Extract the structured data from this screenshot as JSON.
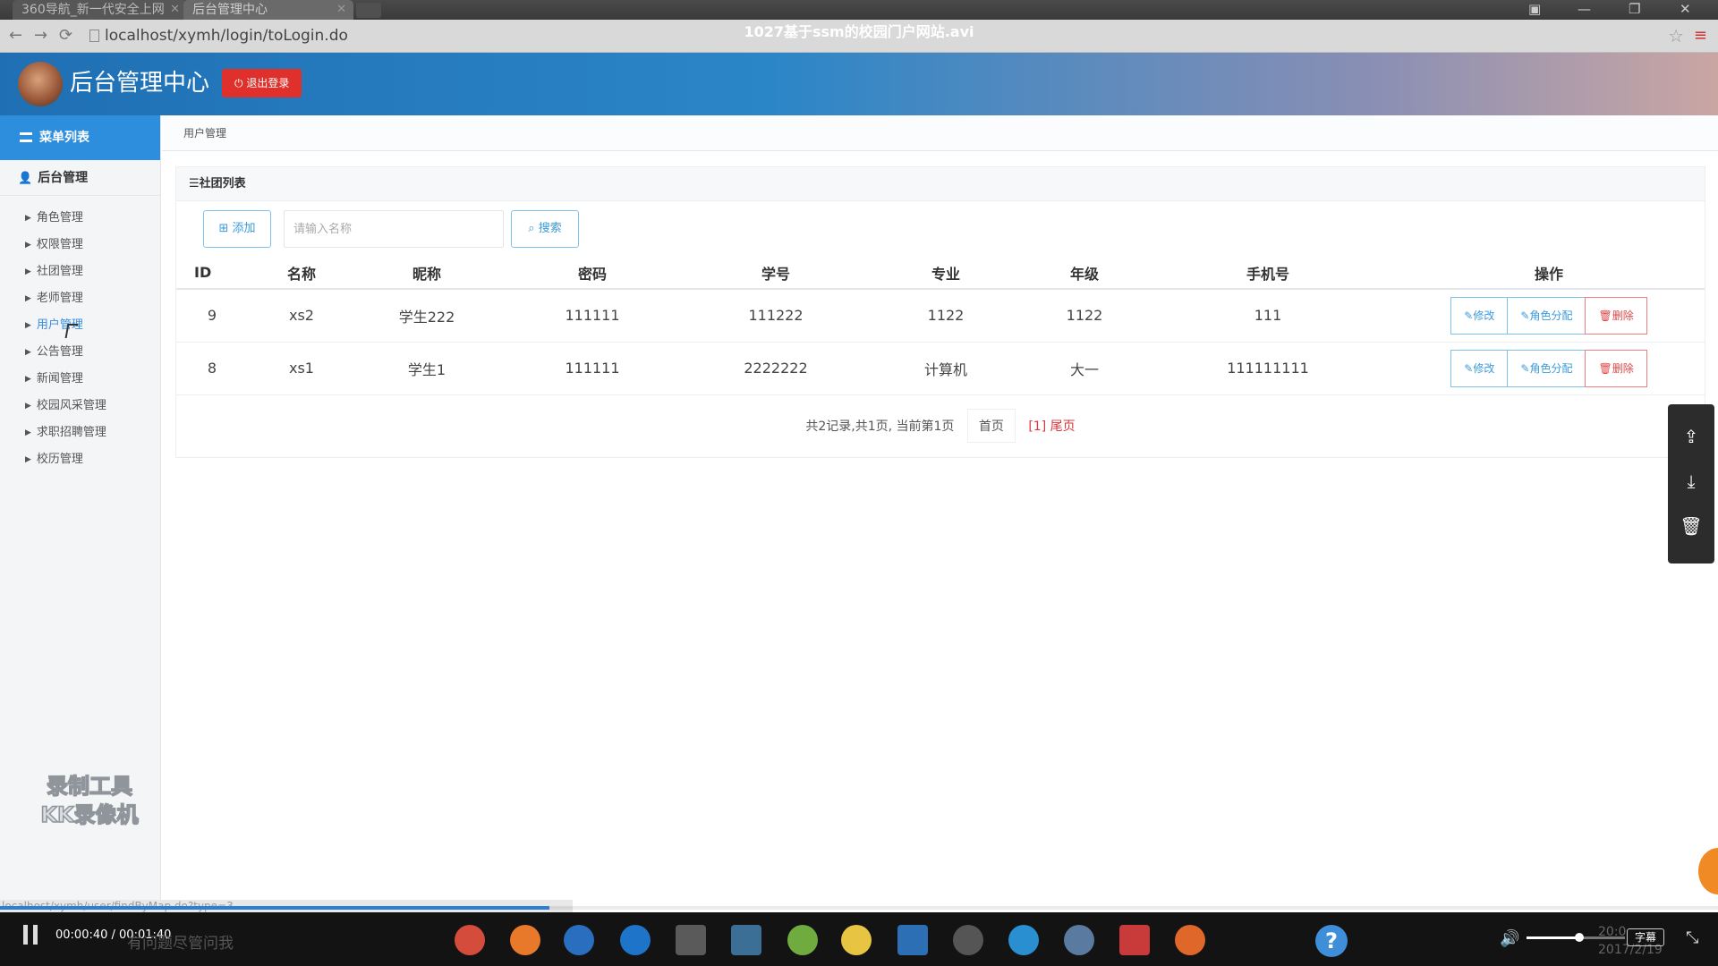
{
  "browser": {
    "tabs": [
      {
        "label": "360导航_新一代安全上网"
      },
      {
        "label": "后台管理中心"
      }
    ],
    "video_title": "1027基于ssm的校园门户网站.avi",
    "url": "localhost/xymh/login/toLogin.do",
    "status_url": "localhost/xymh/user/findByMap.do?type=3"
  },
  "header": {
    "title": "后台管理中心",
    "logout_label": "退出登录"
  },
  "sidebar": {
    "menu_title": "菜单列表",
    "group_label": "后台管理",
    "items": [
      {
        "label": "角色管理"
      },
      {
        "label": "权限管理"
      },
      {
        "label": "社团管理"
      },
      {
        "label": "老师管理"
      },
      {
        "label": "用户管理"
      },
      {
        "label": "公告管理"
      },
      {
        "label": "新闻管理"
      },
      {
        "label": "校园风采管理"
      },
      {
        "label": "求职招聘管理"
      },
      {
        "label": "校历管理"
      }
    ],
    "active_index": 4,
    "watermark_line1": "录制工具",
    "watermark_line2": "KK录像机"
  },
  "breadcrumb": "用户管理",
  "panel": {
    "title": "☰社团列表",
    "add_label": "添加",
    "search_placeholder": "请输入名称",
    "search_label": "搜索"
  },
  "table": {
    "columns": [
      "ID",
      "名称",
      "昵称",
      "密码",
      "学号",
      "专业",
      "年级",
      "手机号",
      "操作"
    ],
    "rows": [
      {
        "id": "9",
        "name": "xs2",
        "nickname": "学生222",
        "password": "111111",
        "student_no": "111222",
        "major": "1122",
        "grade": "1122",
        "phone": "111"
      },
      {
        "id": "8",
        "name": "xs1",
        "nickname": "学生1",
        "password": "111111",
        "student_no": "2222222",
        "major": "计算机",
        "grade": "大一",
        "phone": "111111111"
      }
    ],
    "op_edit": "修改",
    "op_assign": "角色分配",
    "op_delete": "删除"
  },
  "pager": {
    "summary": "共2记录,共1页, 当前第1页",
    "first": "首页",
    "current": "[1]",
    "last": "尾页"
  },
  "player": {
    "time": "00:00:40 / 00:01:40",
    "progress": 0.4,
    "volume": 0.3,
    "subtitle_label": "字幕",
    "taskbar_search_text": "有问题尽管问我",
    "clock_time": "20:0",
    "clock_date": "2017/2/19"
  },
  "colors": {
    "accent": "#2e8ede",
    "danger": "#e0302b",
    "link_red": "#d9363e"
  }
}
